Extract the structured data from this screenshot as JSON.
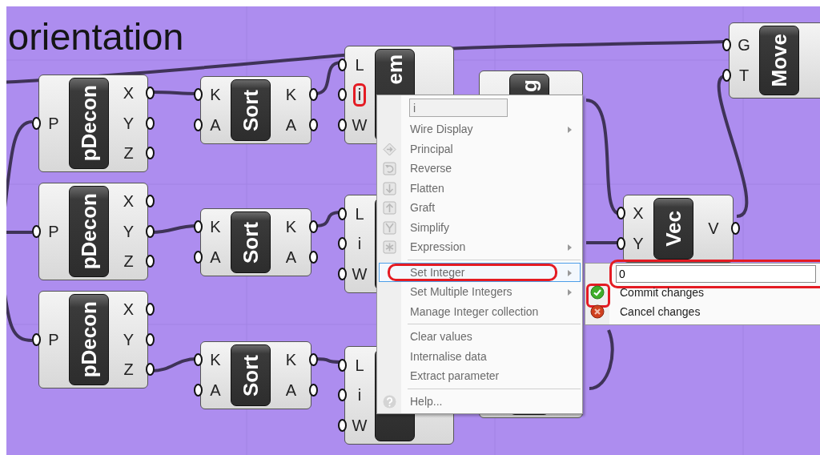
{
  "canvas_title": "orientation",
  "nodes": [
    {
      "kind": "component",
      "name": "pDecon",
      "inputs": [
        {
          "label": "P",
          "annotated": false
        }
      ],
      "outputs": [
        "X",
        "Y",
        "Z"
      ]
    },
    {
      "kind": "component",
      "name": "pDecon",
      "inputs": [
        {
          "label": "P",
          "annotated": false
        }
      ],
      "outputs": [
        "X",
        "Y",
        "Z"
      ]
    },
    {
      "kind": "component",
      "name": "pDecon",
      "inputs": [
        {
          "label": "P",
          "annotated": false
        }
      ],
      "outputs": [
        "X",
        "Y",
        "Z"
      ]
    },
    {
      "kind": "component",
      "name": "Sort",
      "inputs": [
        {
          "label": "K",
          "annotated": false
        },
        {
          "label": "A",
          "annotated": false
        }
      ],
      "outputs": [
        "K",
        "A"
      ]
    },
    {
      "kind": "component",
      "name": "Sort",
      "inputs": [
        {
          "label": "K",
          "annotated": false
        },
        {
          "label": "A",
          "annotated": false
        }
      ],
      "outputs": [
        "K",
        "A"
      ]
    },
    {
      "kind": "component",
      "name": "Sort",
      "inputs": [
        {
          "label": "K",
          "annotated": false
        },
        {
          "label": "A",
          "annotated": false
        }
      ],
      "outputs": [
        "K",
        "A"
      ]
    },
    {
      "kind": "component",
      "name": "em",
      "inputs": [
        {
          "label": "L",
          "annotated": false
        },
        {
          "label": "i",
          "annotated": true
        },
        {
          "label": "W",
          "annotated": false
        }
      ]
    },
    {
      "kind": "component",
      "inputs": [
        {
          "label": "L",
          "annotated": false
        },
        {
          "label": "i",
          "annotated": false
        },
        {
          "label": "W",
          "annotated": false
        }
      ]
    },
    {
      "kind": "component",
      "inputs": [
        {
          "label": "L",
          "annotated": false
        },
        {
          "label": "i",
          "annotated": false
        },
        {
          "label": "W",
          "annotated": false
        }
      ]
    },
    {
      "kind": "component",
      "name": "g"
    },
    {
      "kind": "component"
    },
    {
      "kind": "component",
      "name": "Vec",
      "inputs": [
        {
          "label": "X",
          "annotated": false
        },
        {
          "label": "Y",
          "annotated": false
        }
      ],
      "outputs": [
        "V"
      ]
    },
    {
      "kind": "component",
      "name": "Move",
      "inputs": [
        {
          "label": "G",
          "annotated": false
        },
        {
          "label": "T",
          "annotated": false
        }
      ]
    }
  ],
  "context_menu": {
    "name_field": {
      "value": "i"
    },
    "items": [
      {
        "kind": "submenu",
        "label": "Wire Display",
        "selected": false,
        "annotated": false
      },
      {
        "kind": "command",
        "label": "Principal",
        "selected": false,
        "annotated": false
      },
      {
        "kind": "command",
        "label": "Reverse",
        "selected": false,
        "annotated": false
      },
      {
        "kind": "command",
        "label": "Flatten",
        "selected": false,
        "annotated": false
      },
      {
        "kind": "command",
        "label": "Graft",
        "selected": false,
        "annotated": false
      },
      {
        "kind": "command",
        "label": "Simplify",
        "selected": false,
        "annotated": false
      },
      {
        "kind": "submenu",
        "label": "Expression",
        "selected": false,
        "annotated": false
      },
      {
        "kind": "separator"
      },
      {
        "kind": "submenu",
        "label": "Set Integer",
        "selected": true,
        "annotated": true
      },
      {
        "kind": "submenu",
        "label": "Set Multiple Integers",
        "selected": false,
        "annotated": false
      },
      {
        "kind": "command",
        "label": "Manage Integer collection",
        "selected": false,
        "annotated": false
      },
      {
        "kind": "separator"
      },
      {
        "kind": "command",
        "label": "Clear values",
        "selected": false,
        "annotated": false
      },
      {
        "kind": "command",
        "label": "Internalise data",
        "selected": false,
        "annotated": false
      },
      {
        "kind": "command",
        "label": "Extract parameter",
        "selected": false,
        "annotated": false
      },
      {
        "kind": "separator"
      },
      {
        "kind": "command",
        "label": "Help...",
        "selected": false,
        "annotated": false
      }
    ]
  },
  "submenu": {
    "value": "0",
    "annotated": true,
    "items": [
      {
        "kind": "commit",
        "label": "Commit changes",
        "annotated": true
      },
      {
        "kind": "cancel",
        "label": "Cancel changes",
        "annotated": false
      }
    ]
  }
}
